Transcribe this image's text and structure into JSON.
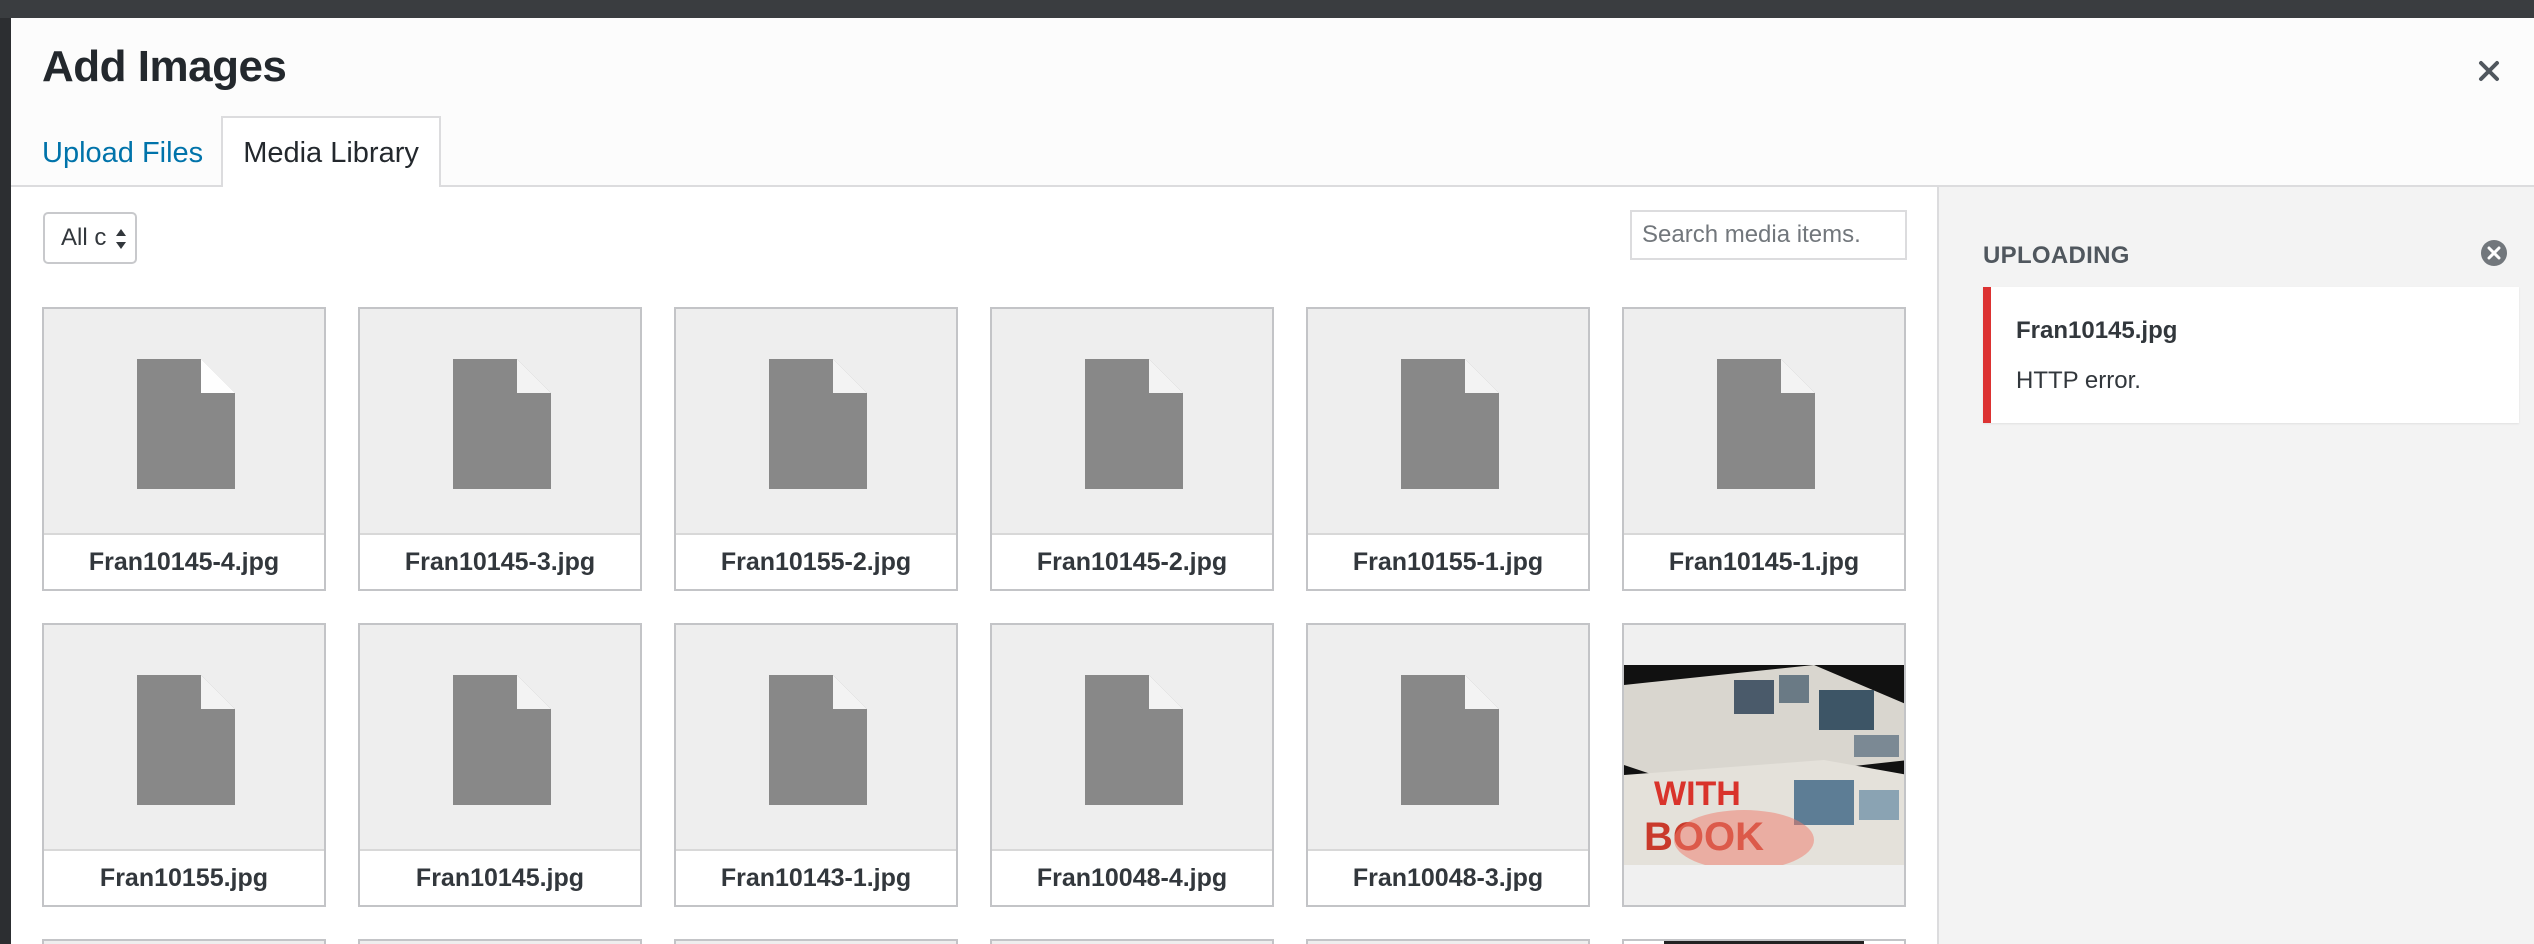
{
  "modal": {
    "title": "Add Images",
    "close_label": "close"
  },
  "tabs": [
    {
      "label": "Upload Files",
      "active": false
    },
    {
      "label": "Media Library",
      "active": true
    }
  ],
  "toolbar": {
    "filter_value": "All c",
    "search_placeholder": "Search media items."
  },
  "media": [
    {
      "filename": "Fran10145-4.jpg",
      "type": "doc"
    },
    {
      "filename": "Fran10145-3.jpg",
      "type": "doc"
    },
    {
      "filename": "Fran10155-2.jpg",
      "type": "doc"
    },
    {
      "filename": "Fran10145-2.jpg",
      "type": "doc"
    },
    {
      "filename": "Fran10155-1.jpg",
      "type": "doc"
    },
    {
      "filename": "Fran10145-1.jpg",
      "type": "doc"
    },
    {
      "filename": "Fran10155.jpg",
      "type": "doc"
    },
    {
      "filename": "Fran10145.jpg",
      "type": "doc"
    },
    {
      "filename": "Fran10143-1.jpg",
      "type": "doc"
    },
    {
      "filename": "Fran10048-4.jpg",
      "type": "doc"
    },
    {
      "filename": "Fran10048-3.jpg",
      "type": "doc"
    },
    {
      "filename": "",
      "type": "photo"
    }
  ],
  "sidebar": {
    "title": "UPLOADING",
    "error": {
      "filename": "Fran10145.jpg",
      "message": "HTTP error."
    }
  },
  "colors": {
    "link": "#0073aa",
    "error_border": "#dc3232",
    "doc_icon": "#888888"
  },
  "icons": {
    "close": "close-icon",
    "dismiss": "dismiss-circle-icon",
    "document": "document-icon",
    "select_arrows": "select-arrows-icon"
  }
}
